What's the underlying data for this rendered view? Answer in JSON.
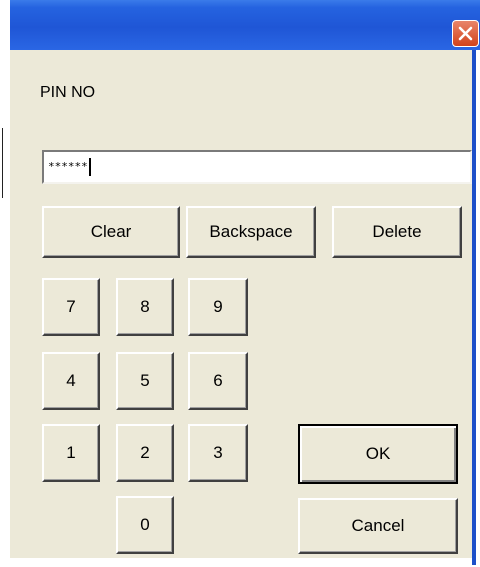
{
  "dialog": {
    "close_icon": "close-icon"
  },
  "pin": {
    "label": "PIN NO",
    "masked_value": "******"
  },
  "actions": {
    "clear": "Clear",
    "backspace": "Backspace",
    "delete": "Delete",
    "ok": "OK",
    "cancel": "Cancel"
  },
  "keypad": {
    "k7": "7",
    "k8": "8",
    "k9": "9",
    "k4": "4",
    "k5": "5",
    "k6": "6",
    "k1": "1",
    "k2": "2",
    "k3": "3",
    "k0": "0"
  },
  "colors": {
    "titlebar": "#2563e0",
    "dialog_bg": "#ece9d8",
    "close_button": "#d2431b"
  }
}
